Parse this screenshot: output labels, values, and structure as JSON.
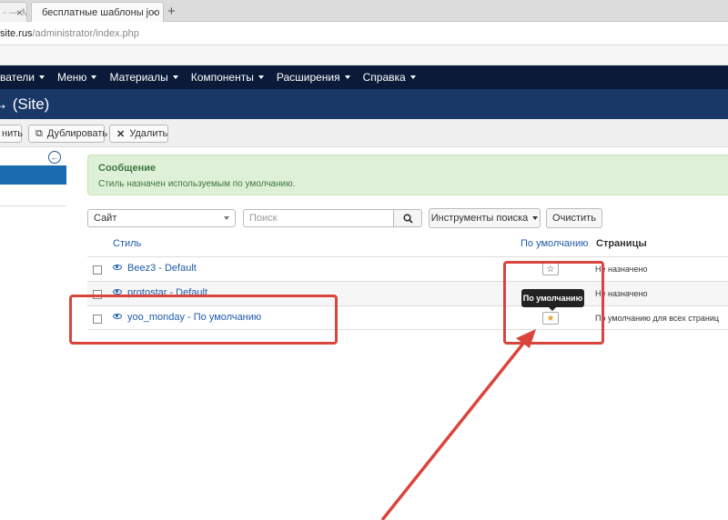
{
  "browser": {
    "tabs": [
      {
        "title": "- — M",
        "active": false
      },
      {
        "title": "бесплатные шаблоны joo",
        "active": true
      }
    ],
    "new_tab": "+",
    "address_host": "site.rus",
    "address_path": "/administrator/index.php"
  },
  "menu": {
    "items": [
      "ватели",
      "Меню",
      "Материалы",
      "Компоненты",
      "Расширения",
      "Справка"
    ]
  },
  "header": {
    "title": "→ (Site)"
  },
  "toolbar": {
    "items": [
      {
        "label": "нить",
        "icon": ""
      },
      {
        "label": "Дублировать",
        "icon": "copy-icon"
      },
      {
        "label": "Удалить",
        "icon": "close-icon"
      }
    ]
  },
  "message": {
    "heading": "Сообщение",
    "text": "Стиль назначен используемым по умолчанию."
  },
  "filters": {
    "client_select": "Сайт",
    "search_placeholder": "Поиск",
    "search_tools": "Инструменты поиска",
    "clear": "Очистить"
  },
  "table": {
    "headers": {
      "style": "Стиль",
      "default": "По умолчанию",
      "pages": "Страницы"
    },
    "rows": [
      {
        "name": "Beez3 - Default",
        "pages": "Не назначено",
        "is_default": false
      },
      {
        "name": "protostar - Default",
        "pages": "Не назначено",
        "is_default": false
      },
      {
        "name": "yoo_monday - По умолчанию",
        "pages": "По умолчанию для всех страниц",
        "is_default": true
      }
    ]
  },
  "tooltip": "По умолчанию",
  "colors": {
    "navbar": "#0a1a38",
    "header": "#1a3867",
    "link": "#1f5ba8",
    "alert_bg": "#dff0d8",
    "annotation": "#d9453c",
    "star_default": "#e5a42b"
  }
}
